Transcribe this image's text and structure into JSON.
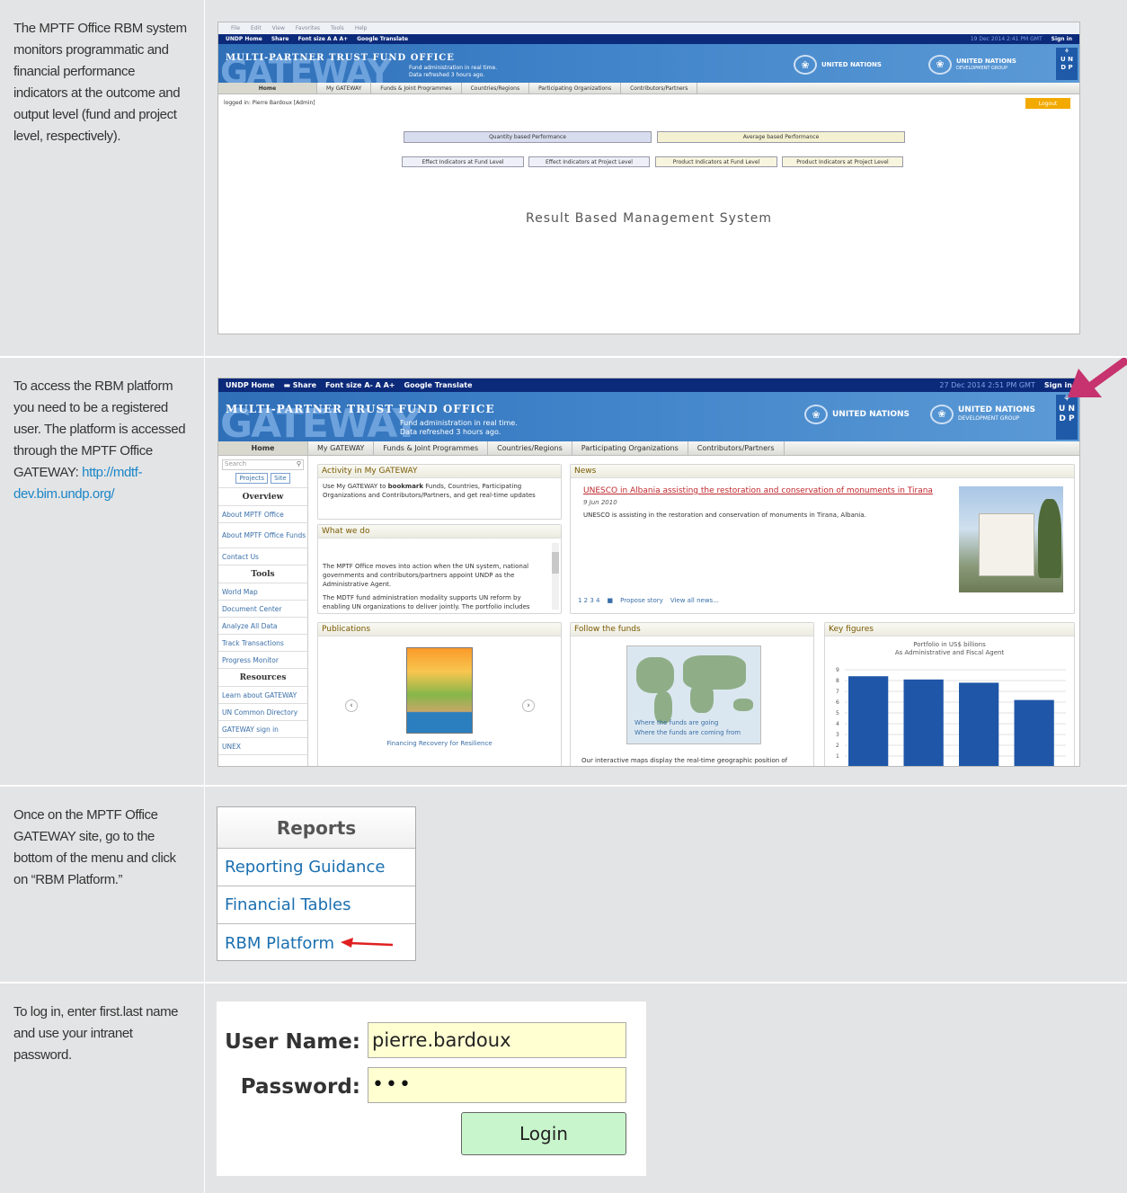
{
  "rows": [
    {
      "text": "The MPTF Office RBM system monitors programmatic and financial performance indicators at the outcome and output level (fund and project level, respectively)."
    },
    {
      "text": "To access the RBM platform you need to be a registered user. The platform is accessed through the MPTF Office GATEWAY:",
      "link": "http://mdtf-dev.bim.undp.org/"
    },
    {
      "text": "Once on the MPTF Office GATEWAY site, go to the bottom of the menu and click on “RBM Platform.”"
    },
    {
      "text": "To log in, enter first.last name and use your intranet password."
    }
  ],
  "shot1": {
    "browser_menu": [
      "File",
      "Edit",
      "View",
      "Favorites",
      "Tools",
      "Help"
    ],
    "utility": [
      "UNDP Home",
      "Share",
      "Font size A A A+",
      "Google Translate"
    ],
    "utility_right": [
      "19 Dec 2014 2:41 PM GMT",
      "Sign in"
    ],
    "mptf": "MULTI-PARTNER TRUST FUND OFFICE",
    "gateway": "GATEWAY",
    "fund_admin": "Fund administration in real time.",
    "refreshed": "Data refreshed 3 hours ago.",
    "un": "UNITED NATIONS",
    "undg1": "UNITED NATIONS",
    "undg2": "DEVELOPMENT GROUP",
    "nav": [
      "Home",
      "My GATEWAY",
      "Funds & Joint Programmes",
      "Countries/Regions",
      "Participating Organizations",
      "Contributors/Partners"
    ],
    "logged": "logged in: Pierre Bardoux [Admin]",
    "logout": "Logout",
    "qty": "Quantity based Performance",
    "avg": "Average based Performance",
    "effect_fund": "Effect Indicators at Fund Level",
    "effect_proj": "Effect Indicators at Project Level",
    "prod_fund": "Product Indicators at Fund Level",
    "prod_proj": "Product Indicators at Project Level",
    "rbm_title": "Result Based Management System"
  },
  "shot2": {
    "utility": [
      "UNDP Home",
      "Share",
      "Font size A- A A+",
      "Google Translate"
    ],
    "utility_right": [
      "27 Dec 2014 2:51 PM GMT",
      "Sign in"
    ],
    "mptf": "MULTI-PARTNER TRUST FUND OFFICE",
    "gateway": "GATEWAY",
    "fund_admin": "Fund administration in real time.",
    "refreshed": "Data refreshed 3 hours ago.",
    "un": "UNITED NATIONS",
    "undg1": "UNITED NATIONS",
    "undg2": "DEVELOPMENT GROUP",
    "nav": [
      "Home",
      "My GATEWAY",
      "Funds & Joint Programmes",
      "Countries/Regions",
      "Participating Organizations",
      "Contributors/Partners"
    ],
    "search_ph": "Search",
    "projects": "Projects",
    "site": "Site",
    "overview": "Overview",
    "side1": [
      "About MPTF Office",
      "About MPTF Office Funds",
      "Contact Us"
    ],
    "tools": "Tools",
    "side2": [
      "World Map",
      "Document Center",
      "Analyze All Data",
      "Track Transactions",
      "Progress Monitor"
    ],
    "resources": "Resources",
    "side3": [
      "Learn about GATEWAY",
      "UN Common Directory",
      "GATEWAY sign in",
      "UNEX"
    ],
    "activity_title": "Activity in My GATEWAY",
    "activity_pre": "Use My GATEWAY to",
    "activity_bold": "bookmark",
    "activity_post": "Funds, Countries, Participating Organizations and Contributors/Partners, and get real-time updates",
    "whatwedo_title": "What we do",
    "wwd1": "The MPTF Office moves into action when the UN system, national governments and contributors/partners appoint UNDP as the Administrative Agent.",
    "wwd2": "The MDTF fund administration modality supports UN reform by enabling UN organizations to deliver jointly. The portfolio includes",
    "news_title": "News",
    "news_headline": "UNESCO in Albania assisting the restoration and conservation of monuments in Tirana",
    "news_date": "9 Jun 2010",
    "news_body": "UNESCO is assisting in the restoration and conservation of monuments in Tirana, Albania.",
    "news_pages": "1 2 3 4",
    "news_propose": "Propose story",
    "news_viewall": "View all news...",
    "pub_title": "Publications",
    "pub_caption": "Financing Recovery for Resilience",
    "follow_title": "Follow the funds",
    "follow1": "Where the funds are going",
    "follow2": "Where the funds are coming from",
    "follow_body": "Our interactive maps display the real-time geographic position of",
    "key_title": "Key figures",
    "key_sub1": "Portfolio in US$ billions",
    "key_sub2": "As Administrative and Fiscal Agent"
  },
  "chart_data": {
    "type": "bar",
    "values": [
      8.4,
      8.1,
      7.8,
      6.2
    ],
    "ylim": [
      0,
      9
    ],
    "yticks": [
      "1",
      "2",
      "3",
      "4",
      "5",
      "6",
      "7",
      "8",
      "9"
    ],
    "grid": true,
    "color": "#1f56a8"
  },
  "menu": {
    "header": "Reports",
    "items": [
      "Reporting Guidance",
      "Financial Tables",
      "RBM Platform"
    ]
  },
  "login": {
    "user_label": "User Name:",
    "user_value": "pierre.bardoux",
    "pass_label": "Password:",
    "pass_value": "•••",
    "button": "Login"
  },
  "colors": {
    "accent_arrow": "#c6336e",
    "link": "#1a86c8",
    "banner": "#3f82c8"
  }
}
